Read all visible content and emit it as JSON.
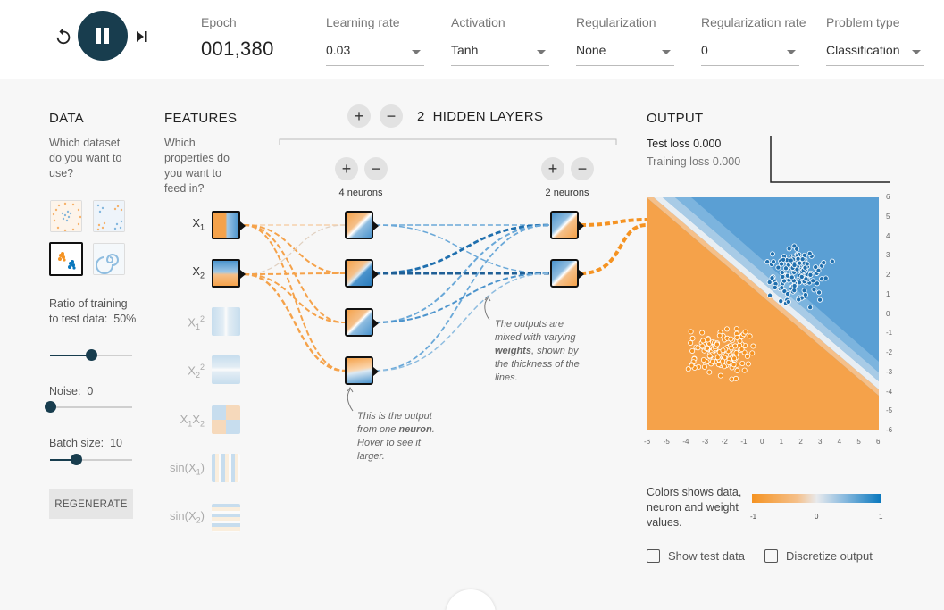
{
  "top": {
    "epoch_label": "Epoch",
    "epoch_value": "001,380",
    "params": [
      {
        "label": "Learning rate",
        "value": "0.03"
      },
      {
        "label": "Activation",
        "value": "Tanh"
      },
      {
        "label": "Regularization",
        "value": "None"
      },
      {
        "label": "Regularization rate",
        "value": "0"
      },
      {
        "label": "Problem type",
        "value": "Classification"
      }
    ]
  },
  "data_panel": {
    "heading": "DATA",
    "question": "Which dataset do you want to use?",
    "ratio_label": "Ratio of training to test data:",
    "ratio_value": "50%",
    "ratio_fraction": 0.5,
    "noise_label": "Noise:",
    "noise_value": "0",
    "noise_fraction": 0,
    "batch_label": "Batch size:",
    "batch_value": "10",
    "batch_fraction": 0.31,
    "regenerate_label": "REGENERATE"
  },
  "features_panel": {
    "heading": "FEATURES",
    "question": "Which properties do you want to feed in?"
  },
  "network": {
    "hidden_layers_count": "2",
    "hidden_layers_label": "HIDDEN LAYERS",
    "layer1_label": "4 neurons",
    "layer2_label": "2 neurons",
    "annot_neuron_pre": "This is the output from one ",
    "annot_neuron_bold": "neuron",
    "annot_neuron_post": ". Hover to see it larger.",
    "annot_weights_pre": "The outputs are mixed with varying ",
    "annot_weights_bold": "weights",
    "annot_weights_post": ", shown by the thickness of the lines."
  },
  "output_panel": {
    "heading": "OUTPUT",
    "test_loss": "Test loss 0.000",
    "training_loss": "Training loss 0.000",
    "legend_text": "Colors shows data, neuron and weight values.",
    "legend_ticks": [
      "-1",
      "0",
      "1"
    ],
    "show_test_label": "Show test data",
    "discretize_label": "Discretize output",
    "x_ticks": [
      "-6",
      "-5",
      "-4",
      "-3",
      "-2",
      "-1",
      "0",
      "1",
      "2",
      "3",
      "4",
      "5",
      "6"
    ],
    "y_ticks": [
      "6",
      "5",
      "4",
      "3",
      "2",
      "1",
      "0",
      "-1",
      "-2",
      "-3",
      "-4",
      "-5",
      "-6"
    ]
  },
  "colors": {
    "orange": "#f59322",
    "blue": "#0877bd",
    "dark": "#183d4e"
  }
}
